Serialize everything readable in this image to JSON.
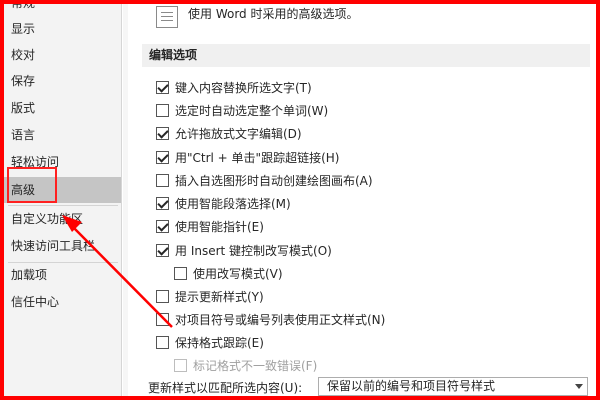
{
  "sidebar": {
    "items": [
      {
        "label": "常规"
      },
      {
        "label": "显示"
      },
      {
        "label": "校对"
      },
      {
        "label": "保存"
      },
      {
        "label": "版式"
      },
      {
        "label": "语言"
      },
      {
        "label": "轻松访问"
      },
      {
        "label": "高级",
        "selected": true
      },
      {
        "label": "自定义功能区"
      },
      {
        "label": "快速访问工具栏"
      },
      {
        "label": "加载项"
      },
      {
        "label": "信任中心"
      }
    ]
  },
  "main": {
    "general_text": "使用 Word 时采用的高级选项。",
    "section_title": "编辑选项",
    "options": [
      {
        "label": "键入内容替换所选文字(T)",
        "checked": true
      },
      {
        "label": "选定时自动选定整个单词(W)",
        "checked": false
      },
      {
        "label": "允许拖放式文字编辑(D)",
        "checked": true
      },
      {
        "label": "用\"Ctrl + 单击\"跟踪超链接(H)",
        "checked": true
      },
      {
        "label": "插入自选图形时自动创建绘图画布(A)",
        "checked": false
      },
      {
        "label": "使用智能段落选择(M)",
        "checked": true
      },
      {
        "label": "使用智能指针(E)",
        "checked": true
      },
      {
        "label": "用 Insert 键控制改写模式(O)",
        "checked": true
      },
      {
        "label": "使用改写模式(V)",
        "checked": false
      },
      {
        "label": "提示更新样式(Y)",
        "checked": false
      },
      {
        "label": "对项目符号或编号列表使用正文样式(N)",
        "checked": false
      },
      {
        "label": "保持格式跟踪(E)",
        "checked": false
      },
      {
        "label": "标记格式不一致错误(F)",
        "checked": false,
        "disabled": true
      }
    ],
    "combo_label": "更新样式以匹配所选内容(U):",
    "combo_value": "保留以前的编号和项目符号样式"
  },
  "colors": {
    "annotation": "#ff0000",
    "sidebar_bg": "#f3f3f3",
    "selected_bg": "#c5c5c5"
  }
}
